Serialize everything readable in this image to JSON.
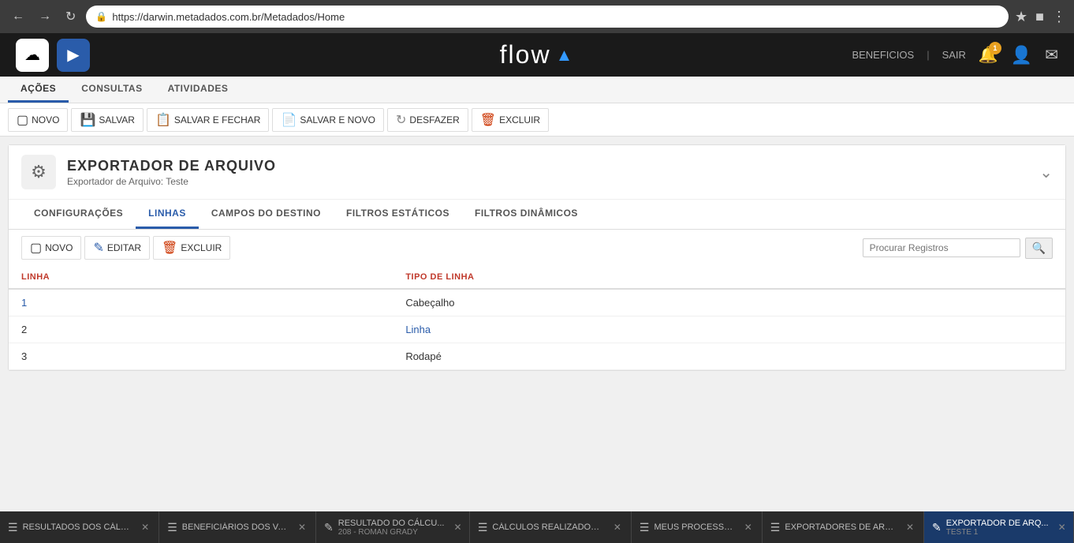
{
  "browser": {
    "url": "https://darwin.metadados.com.br/Metadados/Home",
    "back_btn": "←",
    "forward_btn": "→",
    "refresh_btn": "↺"
  },
  "header": {
    "app_name": "flow",
    "nav_links": {
      "beneficios": "BENEFICIOS",
      "separator": "|",
      "sair": "SAIR"
    },
    "notification_count": "1",
    "icons": {
      "cloud": "☁",
      "arrow": "→",
      "bell": "🔔",
      "user": "👤",
      "mail": "✉"
    }
  },
  "main_tabs": [
    {
      "id": "acoes",
      "label": "AÇÕES",
      "active": true
    },
    {
      "id": "consultas",
      "label": "CONSULTAS",
      "active": false
    },
    {
      "id": "atividades",
      "label": "ATIVIDADES",
      "active": false
    }
  ],
  "toolbar": {
    "novo": "NOVO",
    "salvar": "SALVAR",
    "salvar_fechar": "SALVAR E FECHAR",
    "salvar_novo": "SALVAR E NOVO",
    "desfazer": "DESFAZER",
    "excluir": "EXCLUIR"
  },
  "page": {
    "icon": "⚙",
    "title": "EXPORTADOR DE ARQUIVO",
    "subtitle": "Exportador de Arquivo: Teste"
  },
  "inner_tabs": [
    {
      "id": "configuracoes",
      "label": "CONFIGURAÇÕES",
      "active": false
    },
    {
      "id": "linhas",
      "label": "LINHAS",
      "active": true
    },
    {
      "id": "campos_destino",
      "label": "CAMPOS DO DESTINO",
      "active": false
    },
    {
      "id": "filtros_estaticos",
      "label": "FILTROS ESTÁTICOS",
      "active": false
    },
    {
      "id": "filtros_dinamicos",
      "label": "FILTROS DINÂMICOS",
      "active": false
    }
  ],
  "sub_toolbar": {
    "novo": "NOVO",
    "editar": "EDITAR",
    "excluir": "EXCLUIR",
    "search_placeholder": "Procurar Registros"
  },
  "table": {
    "columns": [
      {
        "id": "linha",
        "label": "LINHA"
      },
      {
        "id": "tipo_linha",
        "label": "TIPO DE LINHA"
      }
    ],
    "rows": [
      {
        "linha": "1",
        "tipo_linha": "Cabeçalho",
        "linha_link": true,
        "tipo_link": false
      },
      {
        "linha": "2",
        "tipo_linha": "Linha",
        "linha_link": false,
        "tipo_link": true
      },
      {
        "linha": "3",
        "tipo_linha": "Rodapé",
        "linha_link": false,
        "tipo_link": false
      }
    ]
  },
  "bottom_tabs": [
    {
      "id": "resultados-calc",
      "icon": "☰",
      "label": "RESULTADOS DOS CÁLC...",
      "sublabel": "",
      "active": false
    },
    {
      "id": "beneficiarios-va",
      "icon": "☰",
      "label": "BENEFICIÁRIOS DOS VA...",
      "sublabel": "",
      "active": false
    },
    {
      "id": "resultado-calcu",
      "icon": "✏",
      "label": "RESULTADO DO CÁLCU...",
      "sublabel": "208 - ROMAN GRADY",
      "active": false
    },
    {
      "id": "calculos-realiz",
      "icon": "☰",
      "label": "CÁLCULOS REALIZADOS ...",
      "sublabel": "",
      "active": false
    },
    {
      "id": "meus-processos",
      "icon": "☰",
      "label": "MEUS PROCESSOS",
      "sublabel": "",
      "active": false
    },
    {
      "id": "exportadores-arq",
      "icon": "☰",
      "label": "EXPORTADORES DE ARQ...",
      "sublabel": "",
      "active": false
    },
    {
      "id": "exportador-arq-active",
      "icon": "✏",
      "label": "EXPORTADOR DE ARQ...",
      "sublabel": "TESTE 1",
      "active": true
    }
  ]
}
